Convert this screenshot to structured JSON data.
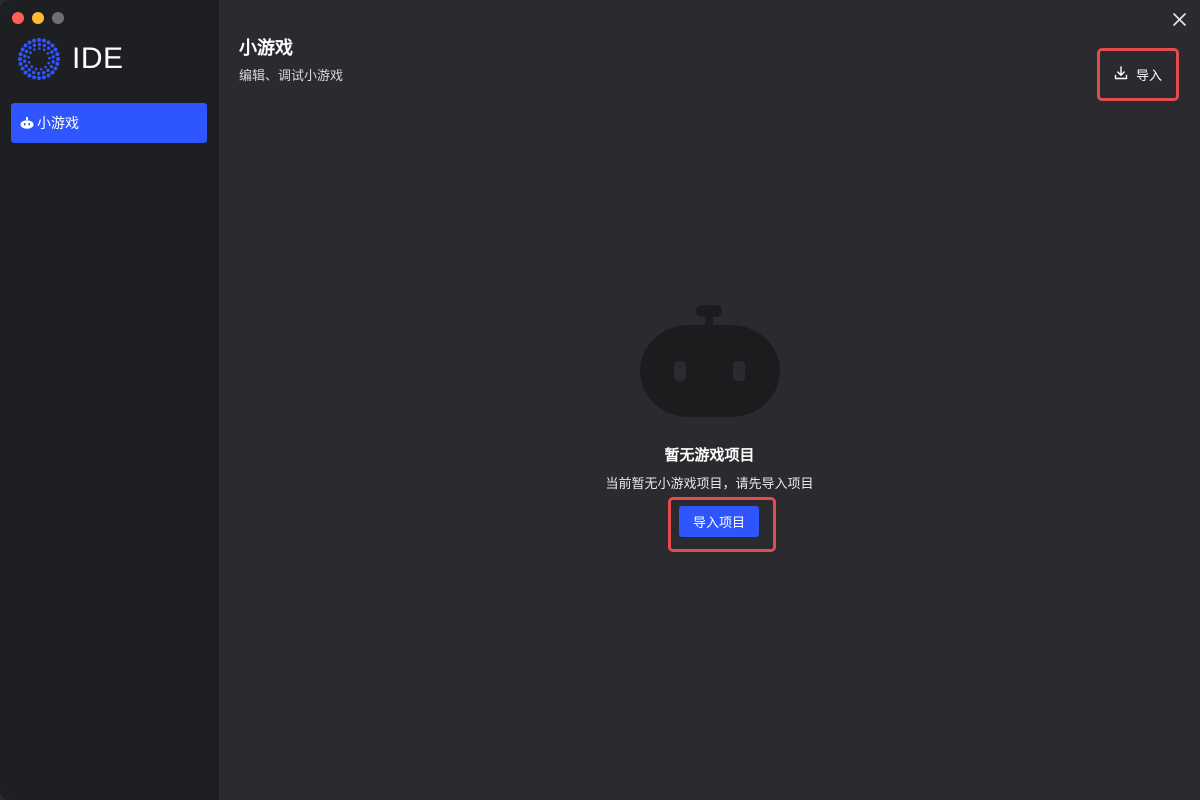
{
  "app": {
    "logo_text": "IDE",
    "logo_icon": "dotted-ring-logo-icon",
    "accent_color": "#2f55ff",
    "highlight_color": "#e34d4d"
  },
  "sidebar": {
    "items": [
      {
        "label": "小游戏",
        "icon": "robot-icon",
        "active": true
      }
    ]
  },
  "header": {
    "title": "小游戏",
    "subtitle": "编辑、调试小游戏",
    "import_label": "导入",
    "import_icon": "download-icon",
    "close_icon": "close-icon"
  },
  "empty_state": {
    "icon": "robot-icon",
    "title": "暂无游戏项目",
    "description": "当前暂无小游戏项目，请先导入项目",
    "button_label": "导入项目"
  }
}
